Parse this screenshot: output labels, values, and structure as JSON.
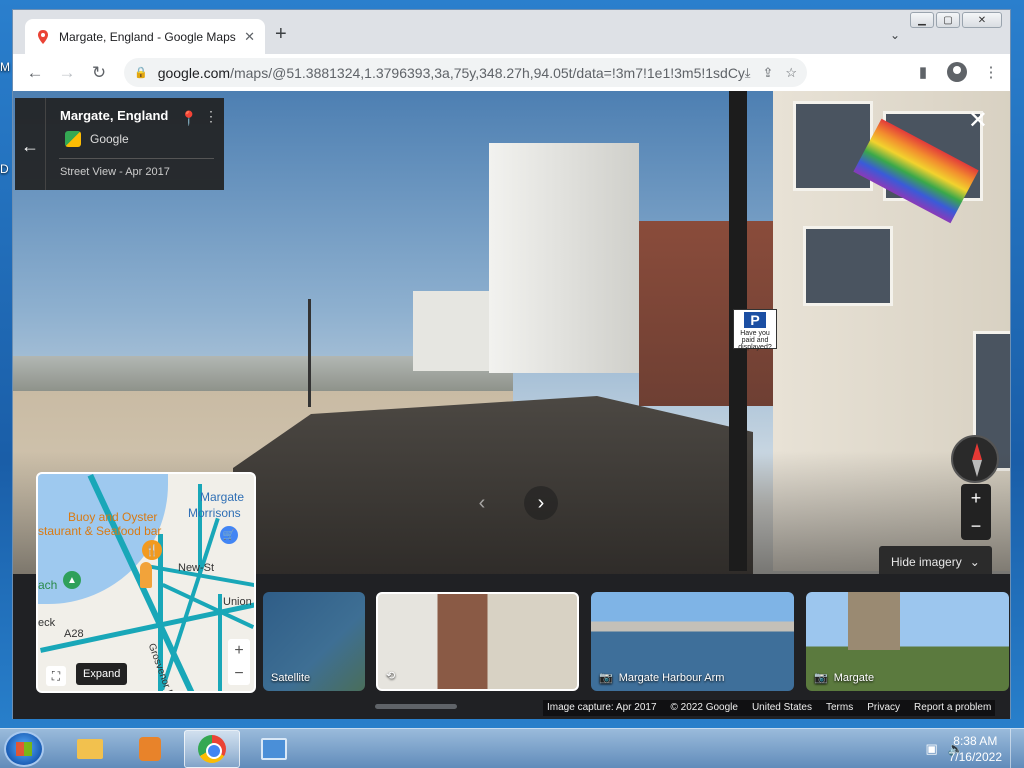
{
  "browser": {
    "tab_title": "Margate, England - Google Maps",
    "url_host": "google.com",
    "url_path": "/maps/@51.3881324,1.3796393,3a,75y,348.27h,94.05t/data=!3m7!1e1!3m5!1sdCySE3iGYW..."
  },
  "desktop": {
    "label_m": "M",
    "label_d": "D"
  },
  "info_card": {
    "title": "Margate, England",
    "provider": "Google",
    "date_label": "Street View - Apr 2017"
  },
  "street_sign": {
    "letter": "P",
    "text": "Have you paid and displayed?"
  },
  "controls": {
    "hide_imagery": "Hide imagery",
    "zoom_in": "+",
    "zoom_out": "−"
  },
  "thumbnails": [
    {
      "label": "Satellite"
    },
    {
      "label": ""
    },
    {
      "label": "Margate Harbour Arm"
    },
    {
      "label": "Margate"
    }
  ],
  "minimap": {
    "labels": {
      "margate": "Margate",
      "morrisons": "Morrisons",
      "buoy": "Buoy and Oyster",
      "restaurant": "staurant & Seafood bar",
      "each": "ach",
      "new_st": "New-St",
      "union": "Union C",
      "a28": "A28",
      "eck": "eck",
      "grosvenor": "Grosvenor Pl"
    },
    "expand_tooltip": "Expand"
  },
  "footer": {
    "capture": "Image capture: Apr 2017",
    "copyright": "© 2022 Google",
    "country": "United States",
    "terms": "Terms",
    "privacy": "Privacy",
    "report": "Report a problem"
  },
  "taskbar": {
    "time": "8:38 AM",
    "date": "7/16/2022"
  },
  "colors": {
    "accent": "#1a73e8",
    "map_road": "#19a7b8",
    "dark_panel": "#202124"
  }
}
